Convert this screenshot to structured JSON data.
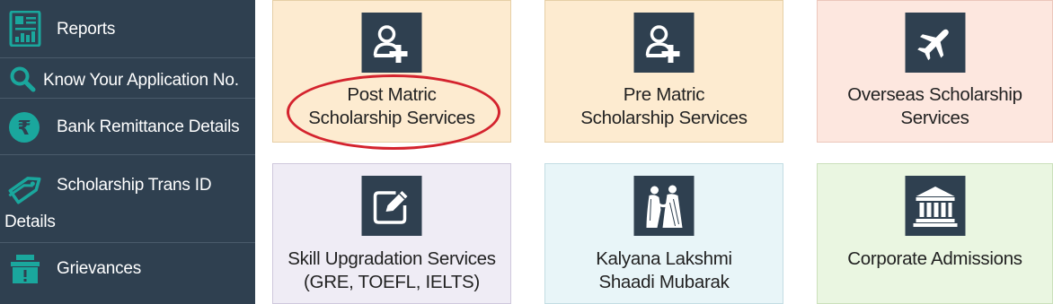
{
  "sidebar": {
    "items": [
      {
        "label": "Reports",
        "icon": "report-icon"
      },
      {
        "label": "Know Your Application No.",
        "icon": "search-icon"
      },
      {
        "label": "Bank Remittance Details",
        "icon": "rupee-icon"
      },
      {
        "label": "Scholarship Trans ID",
        "label_cont": "Details",
        "icon": "tag-icon"
      },
      {
        "label": "Grievances",
        "icon": "grievance-box-icon"
      }
    ],
    "accent": "#1aa79d",
    "background": "#2f4050"
  },
  "tiles": [
    {
      "line1": "Post Matric",
      "line2": "Scholarship Services",
      "icon": "user-add-icon",
      "highlighted": true
    },
    {
      "line1": "Pre Matric",
      "line2": "Scholarship Services",
      "icon": "user-add-icon"
    },
    {
      "line1": "Overseas Scholarship",
      "line2": "Services",
      "icon": "airplane-icon"
    },
    {
      "line1": "Skill Upgradation Services",
      "line2": "(GRE, TOEFL, IELTS)",
      "icon": "edit-icon"
    },
    {
      "line1": "Kalyana Lakshmi",
      "line2": "Shaadi Mubarak",
      "icon": "wedding-couple-icon"
    },
    {
      "line1": "Corporate Admissions",
      "icon": "institution-icon"
    }
  ],
  "colors": {
    "highlight_ring": "#d4232e",
    "icon_box": "#2f4050"
  }
}
